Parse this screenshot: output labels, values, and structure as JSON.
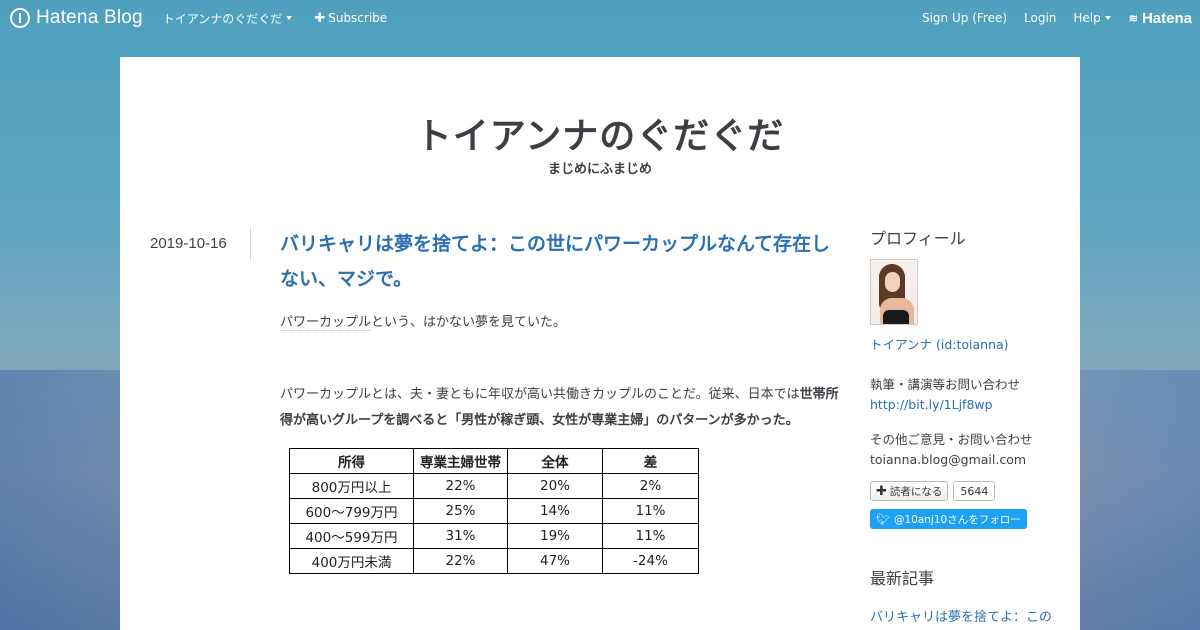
{
  "globalnav": {
    "logo": "Hatena Blog",
    "blog_menu": "トイアンナのぐだぐだ",
    "subscribe": "Subscribe",
    "signup": "Sign Up (Free)",
    "login": "Login",
    "help": "Help",
    "hatena": "Hatena"
  },
  "blog": {
    "title": "トイアンナのぐだぐだ",
    "description": "まじめにふまじめ"
  },
  "entry": {
    "date": "2019-10-16",
    "title": "バリキャリは夢を捨てよ：この世にパワーカップルなんて存在しない、マジで。",
    "p1_keyword": "パワーカップル",
    "p1_rest": "という、はかない夢を見ていた。",
    "p2_plain": "パワーカップルとは、夫・妻ともに年収が高い共働きカップルのことだ。従来、日本では",
    "p2_bold": "世帯所得が高いグループを調べると「男性が稼ぎ頭、女性が専業主婦」のパターンが多かった。",
    "table": {
      "headers": [
        "所得",
        "専業主婦世帯",
        "全体",
        "差"
      ],
      "rows": [
        [
          "800万円以上",
          "22%",
          "20%",
          "2%"
        ],
        [
          "600～799万円",
          "25%",
          "14%",
          "11%"
        ],
        [
          "400～599万円",
          "31%",
          "19%",
          "11%"
        ],
        [
          "400万円未満",
          "22%",
          "47%",
          "-24%"
        ]
      ],
      "negative_color": "#d9262b"
    }
  },
  "sidebar": {
    "profile_heading": "プロフィール",
    "profile_name": "トイアンナ (id:toianna)",
    "contact1_label": "執筆・講演等お問い合わせ",
    "contact1_url": "http://bit.ly/1Ljf8wp",
    "contact2_label": "その他ご意見・お問い合わせ",
    "contact2_email": "toianna.blog@gmail.com",
    "reader_button": "読者になる",
    "reader_count": "5644",
    "twitter_button": "@10anj10さんをフォロー",
    "recent_heading": "最新記事",
    "recent_title": "バリキャリは夢を捨てよ：この世にパワーカップルな"
  },
  "colors": {
    "link": "#2a6fb0",
    "twitter": "#1da1f2"
  }
}
